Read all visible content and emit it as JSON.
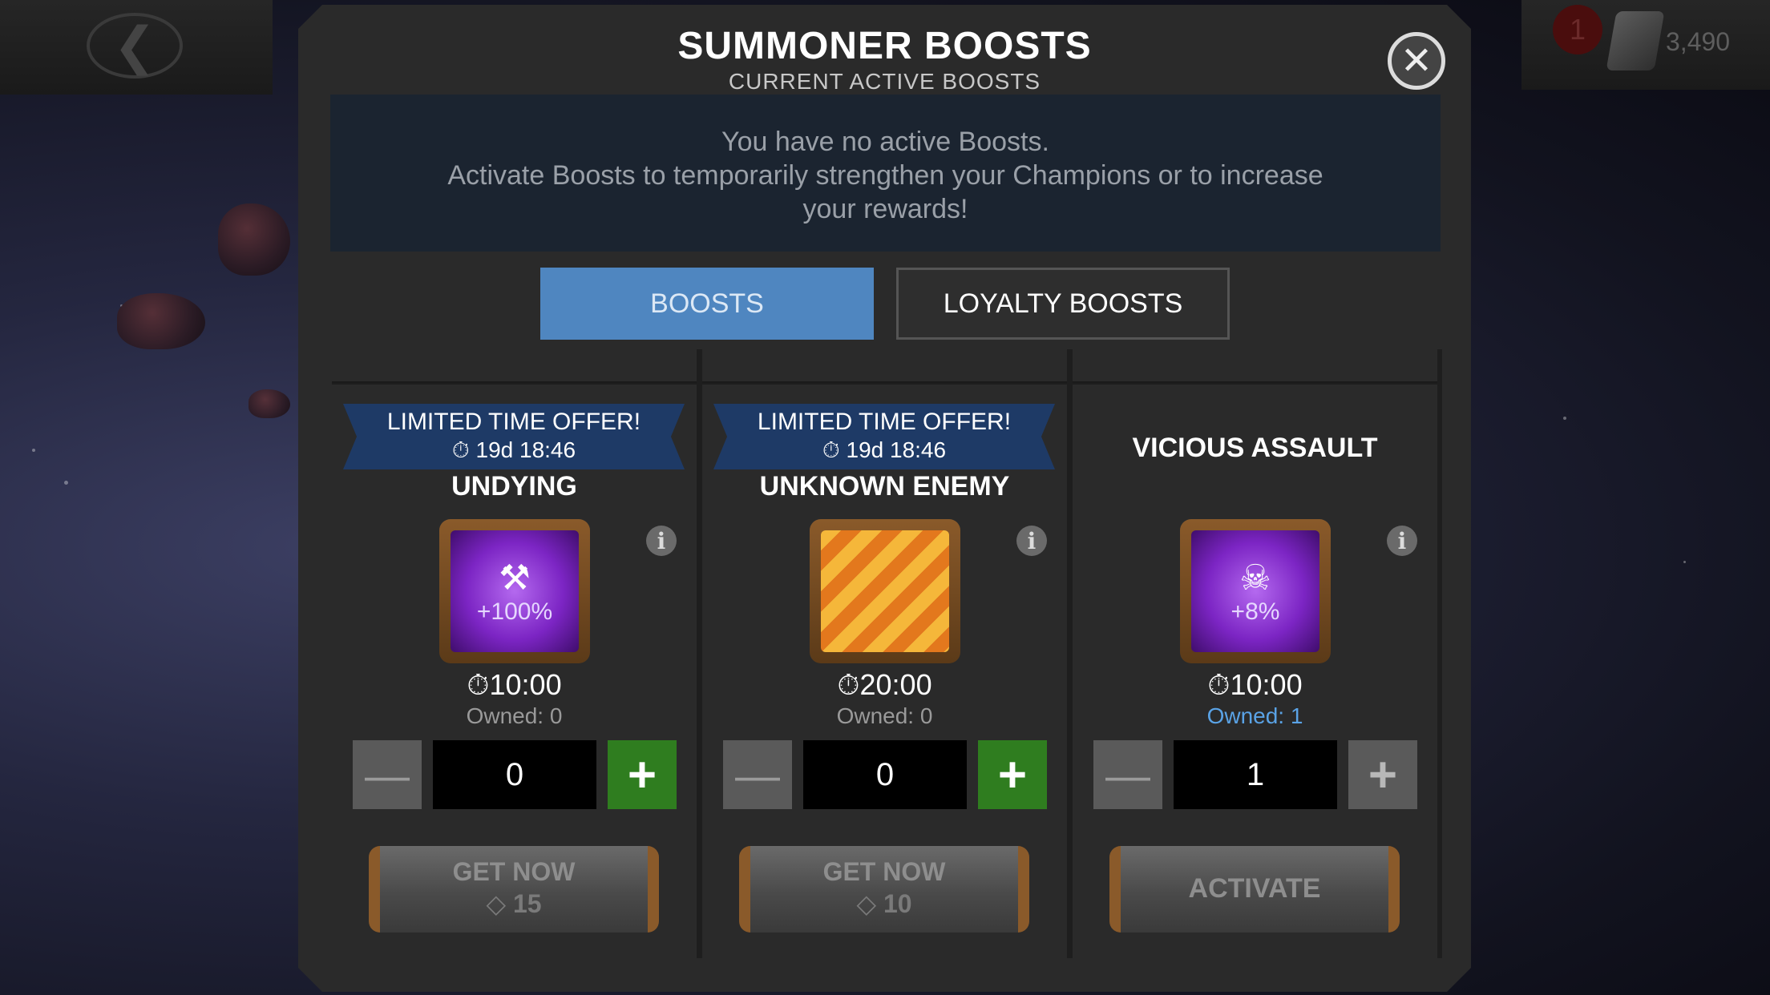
{
  "header": {
    "title": "SUMMONER BOOSTS",
    "subtitle": "CURRENT ACTIVE BOOSTS"
  },
  "topbar": {
    "notification_count": "1",
    "units": "3,490"
  },
  "info": {
    "line1": "You have no active Boosts.",
    "line2": "Activate Boosts to temporarily strengthen your Champions or to increase",
    "line3": "your rewards!"
  },
  "tabs": [
    {
      "label": "BOOSTS",
      "active": true
    },
    {
      "label": "LOYALTY BOOSTS",
      "active": false
    }
  ],
  "cards": [
    {
      "offer_title": "LIMITED TIME OFFER!",
      "offer_timer": "19d 18:46",
      "name": "UNDYING",
      "art_text": "+100%",
      "duration": "10:00",
      "owned": "Owned: 0",
      "quantity": "0",
      "action_label": "GET NOW",
      "action_cost": "15"
    },
    {
      "offer_title": "LIMITED TIME OFFER!",
      "offer_timer": "19d 18:46",
      "name": "UNKNOWN ENEMY",
      "art_text": "",
      "duration": "20:00",
      "owned": "Owned: 0",
      "quantity": "0",
      "action_label": "GET NOW",
      "action_cost": "10"
    },
    {
      "name": "VICIOUS ASSAULT",
      "art_text": "+8%",
      "duration": "10:00",
      "owned": "Owned: 1",
      "quantity": "1",
      "action_label": "ACTIVATE"
    }
  ],
  "icons": {
    "back": "back-arrow-icon",
    "close": "close-icon",
    "timer": "stopwatch-icon",
    "info": "info-icon",
    "unit": "unit-currency-icon"
  },
  "colors": {
    "tab_active": "#4f86c0",
    "plus_green": "#2f7d1f",
    "ribbon": "#1e3a66",
    "owned_blue": "#5aa3e6"
  }
}
